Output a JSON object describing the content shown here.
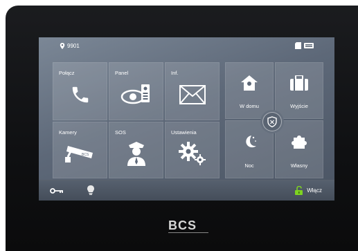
{
  "status": {
    "location_code": "9901"
  },
  "tiles": [
    {
      "id": "polacz",
      "label": "Połącz"
    },
    {
      "id": "panel",
      "label": "Panel"
    },
    {
      "id": "inf",
      "label": "Inf."
    },
    {
      "id": "kamery",
      "label": "Kamery"
    },
    {
      "id": "sos",
      "label": "SOS"
    },
    {
      "id": "ustawienia",
      "label": "Ustawienia"
    }
  ],
  "modes": [
    {
      "id": "wdomu",
      "label": "W domu"
    },
    {
      "id": "wyjscie",
      "label": "Wyjście"
    },
    {
      "id": "noc",
      "label": "Noc"
    },
    {
      "id": "wlasny",
      "label": "Własny"
    }
  ],
  "bottom": {
    "unlock_label": "Włącz"
  },
  "brand": {
    "logo": "BCS"
  },
  "colors": {
    "unlock_icon": "#7ed321"
  }
}
